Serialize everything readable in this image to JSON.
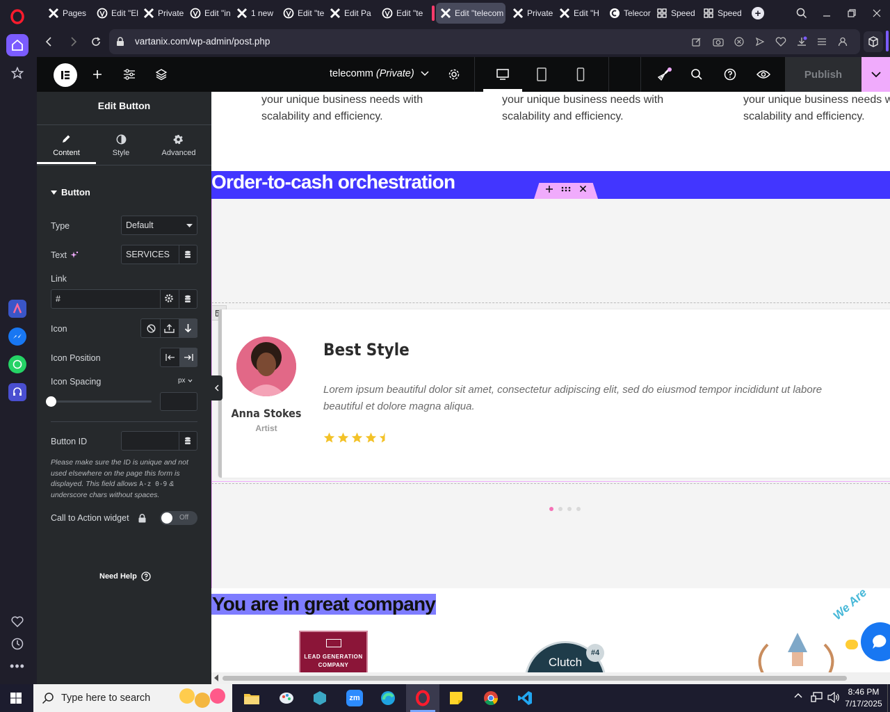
{
  "browser": {
    "tabs": [
      {
        "label": "Pages"
      },
      {
        "label": "Edit \"El"
      },
      {
        "label": "Private"
      },
      {
        "label": "Edit \"in"
      },
      {
        "label": "1 new"
      },
      {
        "label": "Edit \"te"
      },
      {
        "label": "Edit Pa"
      },
      {
        "label": "Edit \"te"
      },
      {
        "label": "Edit \"telecom"
      },
      {
        "label": "Private"
      },
      {
        "label": "Edit \"H"
      },
      {
        "label": "Telecor"
      },
      {
        "label": "Speed"
      },
      {
        "label": "Speed"
      }
    ],
    "url": "vartanix.com/wp-admin/post.php"
  },
  "editor": {
    "page_name": "telecomm",
    "page_status": "(Private)",
    "publish_label": "Publish"
  },
  "panel": {
    "title": "Edit Button",
    "tabs": {
      "content": "Content",
      "style": "Style",
      "advanced": "Advanced"
    },
    "section": "Button",
    "type_label": "Type",
    "type_value": "Default",
    "text_label": "Text",
    "text_value": "SERVICES",
    "link_label": "Link",
    "link_value": "#",
    "icon_label": "Icon",
    "icon_position_label": "Icon Position",
    "icon_spacing_label": "Icon Spacing",
    "icon_spacing_unit": "px",
    "icon_spacing_slider": 0,
    "button_id_label": "Button ID",
    "note_1": "Please make sure the ID is unique and not",
    "note_2": "used elsewhere on the page this form is",
    "note_3": "displayed. This field allows",
    "note_code": "A-z 0-9",
    "note_4": "&",
    "note_5": "underscore chars without spaces.",
    "cta_label": "Call to Action widget",
    "cta_toggle": "Off",
    "need_help": "Need Help"
  },
  "canvas": {
    "col_text_1": "your unique business needs with",
    "col_text_2": "scalability and efficiency.",
    "col3_text_1": "your unique business needs w",
    "banner_heading": "Order-to-cash orchestration",
    "testimonial": {
      "name": "Anna Stokes",
      "role": "Artist",
      "title": "Best Style",
      "quote_1": "Lorem ipsum beautiful dolor sit amet, consectetur adipiscing elit, sed do eiusmod tempor incididunt ut labore",
      "quote_2": "beautiful et dolore magna aliqua.",
      "rating": 4.5
    },
    "company_heading": "You are in great company",
    "logo1_line1": "LEAD GENERATION",
    "logo1_line2": "COMPANY",
    "clutch": "Clutch",
    "clutch_rank": "#4",
    "we_are": "We Are"
  },
  "taskbar": {
    "search_placeholder": "Type here to search",
    "time": "8:46 PM",
    "date": "7/17/2025"
  },
  "colors": {
    "banner": "#4236ff",
    "elementor_pink": "#f0abfc",
    "star": "#f3c228",
    "opera_red": "#ff1b2d"
  }
}
